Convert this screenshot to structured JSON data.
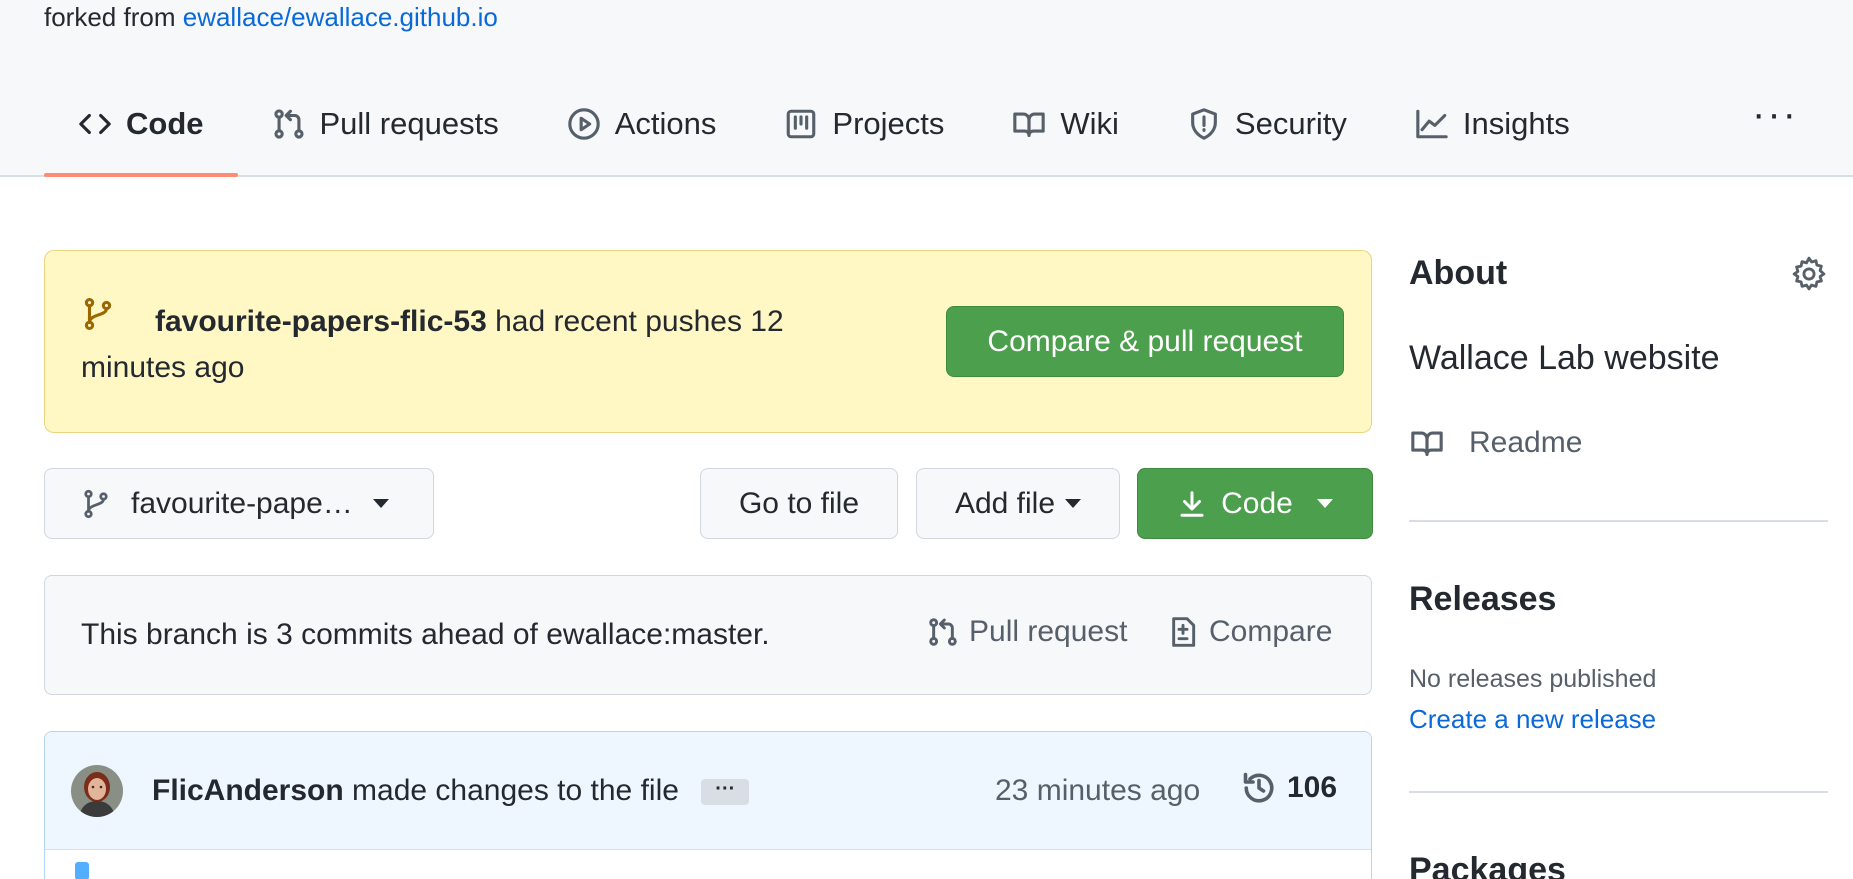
{
  "header": {
    "forked_prefix": "forked from",
    "forked_link": "ewallace/ewallace.github.io",
    "tabs": [
      {
        "label": "Code",
        "icon": "code-icon",
        "active": true
      },
      {
        "label": "Pull requests",
        "icon": "git-pull-request-icon"
      },
      {
        "label": "Actions",
        "icon": "play-icon"
      },
      {
        "label": "Projects",
        "icon": "project-icon"
      },
      {
        "label": "Wiki",
        "icon": "book-icon"
      },
      {
        "label": "Security",
        "icon": "shield-icon"
      },
      {
        "label": "Insights",
        "icon": "graph-icon"
      }
    ],
    "more_label": "···"
  },
  "banner": {
    "branch": "favourite-papers-flic-53",
    "message": "had recent pushes 12 minutes ago",
    "button": "Compare & pull request"
  },
  "file_nav": {
    "branch_label": "favourite-pape…",
    "goto_label": "Go to file",
    "add_label": "Add file",
    "code_label": "Code"
  },
  "ahead": {
    "text": "This branch is 3 commits ahead of ewallace:master.",
    "pull_request": "Pull request",
    "compare": "Compare"
  },
  "commit": {
    "author": "FlicAnderson",
    "message": "made changes to the file",
    "ellipsis": "···",
    "time": "23 minutes ago",
    "count": "106"
  },
  "sidebar": {
    "about_title": "About",
    "description": "Wallace Lab website",
    "readme": "Readme",
    "releases_title": "Releases",
    "releases_none": "No releases published",
    "releases_create": "Create a new release",
    "packages_title": "Packages"
  },
  "colors": {
    "accent_green": "#4c9f4c",
    "tab_underline": "#fd8c73",
    "banner_bg": "#fff8c5",
    "link": "#0969da"
  }
}
